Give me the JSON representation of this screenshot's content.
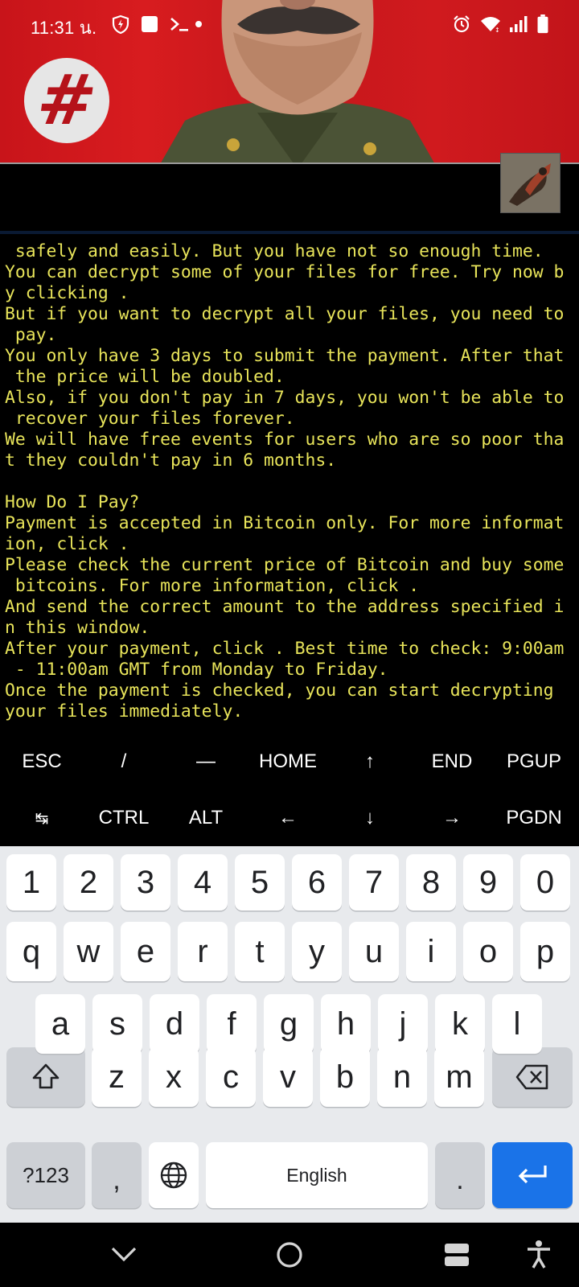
{
  "status_bar": {
    "time": "11:31 น.",
    "left_icons": [
      "shield-icon",
      "square-icon",
      "terminal-prompt-icon",
      "dot-icon"
    ],
    "right_icons": [
      "alarm-icon",
      "wifi-icon",
      "signal-icon",
      "battery-icon"
    ]
  },
  "terminal": {
    "lines": [
      " safely and easily. But you have not so enough time.",
      "You can decrypt some of your files for free. Try now b",
      "y clicking .",
      "But if you want to decrypt all your files, you need to",
      " pay.",
      "You only have 3 days to submit the payment. After that",
      " the price will be doubled.",
      "Also, if you don't pay in 7 days, you won't be able to",
      " recover your files forever.",
      "We will have free events for users who are so poor tha",
      "t they couldn't pay in 6 months.",
      "",
      "How Do I Pay?",
      "Payment is accepted in Bitcoin only. For more informat",
      "ion, click .",
      "Please check the current price of Bitcoin and buy some",
      " bitcoins. For more information, click .",
      "And send the correct amount to the address specified i",
      "n this window.",
      "After your payment, click . Best time to check: 9:00am",
      " - 11:00am GMT from Monday to Friday.",
      "Once the payment is checked, you can start decrypting",
      "your files immediately."
    ],
    "text_color": "#e8e45a"
  },
  "extra_keys": {
    "row1": [
      "ESC",
      "/",
      "—",
      "HOME",
      "↑",
      "END",
      "PGUP"
    ],
    "row2": [
      "↹",
      "CTRL",
      "ALT",
      "←",
      "↓",
      "→",
      "PGDN"
    ]
  },
  "keyboard": {
    "numbers": [
      "1",
      "2",
      "3",
      "4",
      "5",
      "6",
      "7",
      "8",
      "9",
      "0"
    ],
    "row1": [
      "q",
      "w",
      "e",
      "r",
      "t",
      "y",
      "u",
      "i",
      "o",
      "p"
    ],
    "row2": [
      "a",
      "s",
      "d",
      "f",
      "g",
      "h",
      "j",
      "k",
      "l"
    ],
    "row3": [
      "z",
      "x",
      "c",
      "v",
      "b",
      "n",
      "m"
    ],
    "symbols_label": "?123",
    "comma": ",",
    "space_label": "English",
    "period": ".",
    "accent_color": "#1a73e8"
  },
  "nav_bar": {
    "icons": [
      "chevron-down-icon",
      "home-circle-icon",
      "recents-icon",
      "accessibility-icon"
    ]
  }
}
